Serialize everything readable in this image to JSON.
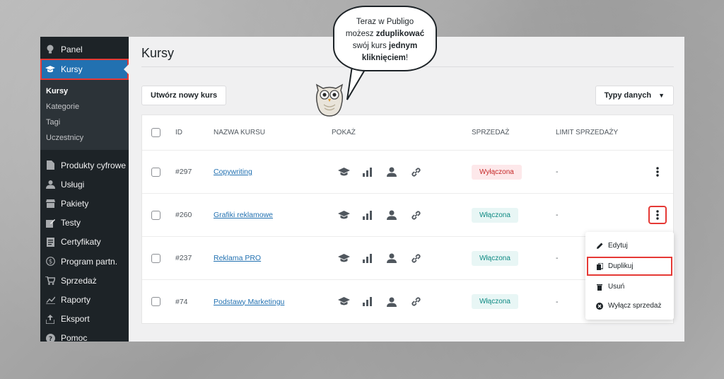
{
  "sidebar": {
    "top_items": [
      {
        "label": "Panel",
        "icon": "bulb-icon"
      }
    ],
    "active_item": {
      "label": "Kursy",
      "icon": "graduation-cap-icon"
    },
    "submenu": [
      "Kursy",
      "Kategorie",
      "Tagi",
      "Uczestnicy"
    ],
    "items": [
      {
        "label": "Produkty cyfrowe",
        "icon": "file-icon"
      },
      {
        "label": "Usługi",
        "icon": "users-icon"
      },
      {
        "label": "Pakiety",
        "icon": "shop-icon"
      },
      {
        "label": "Testy",
        "icon": "edit-icon"
      },
      {
        "label": "Certyfikaty",
        "icon": "certificate-icon"
      },
      {
        "label": "Program partn.",
        "icon": "dollar-icon"
      },
      {
        "label": "Sprzedaż",
        "icon": "cart-icon"
      },
      {
        "label": "Raporty",
        "icon": "chart-icon"
      },
      {
        "label": "Eksport",
        "icon": "export-icon"
      },
      {
        "label": "Pomoc",
        "icon": "help-icon"
      }
    ]
  },
  "page": {
    "title": "Kursy",
    "new_button": "Utwórz nowy kurs",
    "types_button": "Typy danych"
  },
  "table": {
    "headers": {
      "id": "ID",
      "name": "NAZWA KURSU",
      "show": "POKAŻ",
      "sale": "SPRZEDAŻ",
      "limit": "LIMIT SPRZEDAŻY"
    },
    "rows": [
      {
        "id": "#297",
        "name": "Copywriting",
        "sale": "Wyłączona",
        "sale_state": "off",
        "limit": "-"
      },
      {
        "id": "#260",
        "name": "Grafiki reklamowe",
        "sale": "Włączona",
        "sale_state": "on",
        "limit": "-"
      },
      {
        "id": "#237",
        "name": "Reklama PRO",
        "sale": "Włączona",
        "sale_state": "on",
        "limit": "-"
      },
      {
        "id": "#74",
        "name": "Podstawy Marketingu",
        "sale": "Włączona",
        "sale_state": "on",
        "limit": "-"
      }
    ]
  },
  "dropdown": {
    "items": [
      "Edytuj",
      "Duplikuj",
      "Usuń",
      "Wyłącz sprzedaż"
    ]
  },
  "bubble": {
    "line1": "Teraz w Publigo",
    "line2_pre": "możesz ",
    "line2_bold": "zduplikować",
    "line3_pre": "swój kurs ",
    "line3_bold": "jednym",
    "line4_bold": "kliknięciem",
    "line4_post": "!"
  },
  "colors": {
    "accent": "#2271b1",
    "highlight": "#e53935",
    "sidebar": "#1d2327",
    "on": "#0e8a83",
    "off": "#c62828"
  }
}
